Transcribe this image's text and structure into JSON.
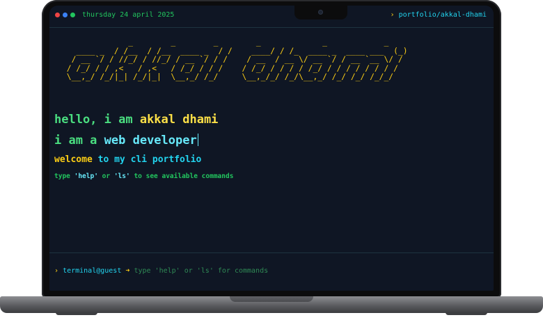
{
  "window": {
    "dots": [
      {
        "name": "red",
        "color": "#ef4444"
      },
      {
        "name": "blue",
        "color": "#3b82f6"
      },
      {
        "name": "green",
        "color": "#22c55e"
      }
    ],
    "date": "thursday 24 april 2025",
    "path_caret": "›",
    "path": "portfolio/akkal-dhami"
  },
  "banner": {
    "ascii": "              _        _        _        _             _            _\n   ____ _  / /__  / /__  ____ _  / /    ____/ / /_  ____ _  ____ ___  (_)\n  / __ `/ / //_/ / //_/ / __ `/ / /    / __  / __ \\/ __ `/ / __ `__ \\/ /\n / /_/ / / ,<   / ,<   / /_/ / / /    / /_/ / / / / /_/ / / / / / / / /\n \\__,_/ /_/|_| /_/|_|  \\__,_/ /_/     \\__,_/_/ /_/\\__,_/ /_/ /_/ /_/_/"
  },
  "intro": {
    "hello_prefix": "hello, i am ",
    "hello_name": "akkal dhami",
    "role_prefix": "i am a ",
    "role": "web developer",
    "welcome_word": "welcome",
    "welcome_rest": " to my cli portfolio",
    "help_type": "type ",
    "help_cmd1": "'help'",
    "help_or": " or ",
    "help_cmd2": "'ls'",
    "help_rest": " to see available commands"
  },
  "prompt": {
    "caret": "›",
    "user": "terminal@guest",
    "arrow": "➜",
    "placeholder": "type 'help' or 'ls' for commands"
  }
}
